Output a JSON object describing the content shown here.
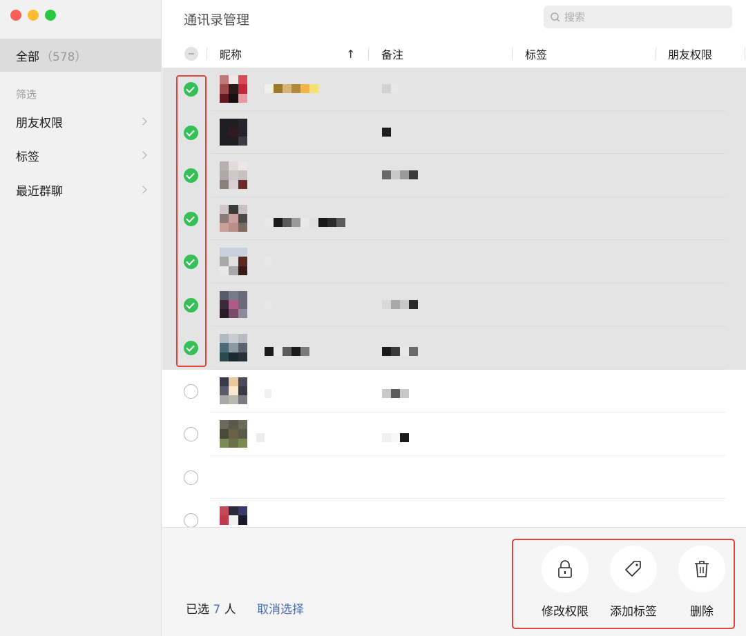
{
  "window": {
    "controls": [
      "close",
      "minimize",
      "maximize"
    ]
  },
  "sidebar": {
    "all_label": "全部",
    "all_count": "（578）",
    "filter_heading": "筛选",
    "items": [
      {
        "label": "朋友权限"
      },
      {
        "label": "标签"
      },
      {
        "label": "最近群聊"
      }
    ]
  },
  "header": {
    "title": "通讯录管理",
    "search_placeholder": "搜索"
  },
  "table": {
    "columns": {
      "nickname": "昵称",
      "sort_arrow": "↑",
      "remark": "备注",
      "tags": "标签",
      "friend_permission": "朋友权限"
    },
    "rows": [
      {
        "selected": true
      },
      {
        "selected": true
      },
      {
        "selected": true
      },
      {
        "selected": true
      },
      {
        "selected": true
      },
      {
        "selected": true
      },
      {
        "selected": true
      },
      {
        "selected": false
      },
      {
        "selected": false
      },
      {
        "selected": false
      },
      {
        "selected": false
      }
    ]
  },
  "footer": {
    "selected_prefix": "已选",
    "selected_count": "7",
    "selected_suffix": "人",
    "cancel_selection": "取消选择",
    "actions": [
      {
        "label": "修改权限",
        "icon": "lock-icon"
      },
      {
        "label": "添加标签",
        "icon": "tag-icon"
      },
      {
        "label": "删除",
        "icon": "trash-icon"
      }
    ]
  },
  "colors": {
    "check_green": "#35c057",
    "highlight_red": "#e0453a",
    "link_blue": "#4b6fae",
    "selected_row": "#e4e4e4"
  }
}
